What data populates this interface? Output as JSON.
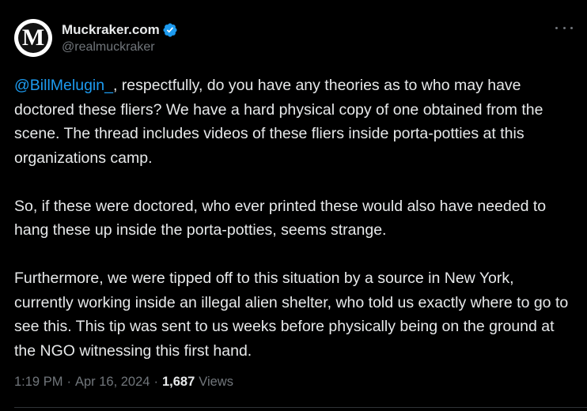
{
  "author": {
    "display_name": "Muckraker.com",
    "handle": "@realmuckraker",
    "avatar_letter": "M",
    "verified": true
  },
  "tweet": {
    "mention": "@BillMelugin_",
    "paragraph1_rest": ", respectfully, do you have any theories as to who may have doctored these fliers? We have a hard physical copy of one obtained from the scene. The thread includes videos of these fliers inside porta-potties at this organizations camp.",
    "paragraph2": "So, if these were doctored, who ever printed these would also have needed to hang these up inside the porta-potties, seems strange.",
    "paragraph3": "Furthermore, we were tipped off to this situation by a source in New York, currently working inside an illegal alien shelter, who told us exactly where to go to see this. This tip was sent to us weeks before physically being on the ground at the NGO witnessing this first hand."
  },
  "meta": {
    "time": "1:19 PM",
    "separator": "·",
    "date": "Apr 16, 2024",
    "views_count": "1,687",
    "views_label": "Views"
  },
  "icons": {
    "verified": "verified-badge-icon",
    "more": "more-options-icon"
  },
  "colors": {
    "background": "#000000",
    "text": "#e7e9ea",
    "secondary": "#71767b",
    "accent": "#1d9bf0"
  }
}
